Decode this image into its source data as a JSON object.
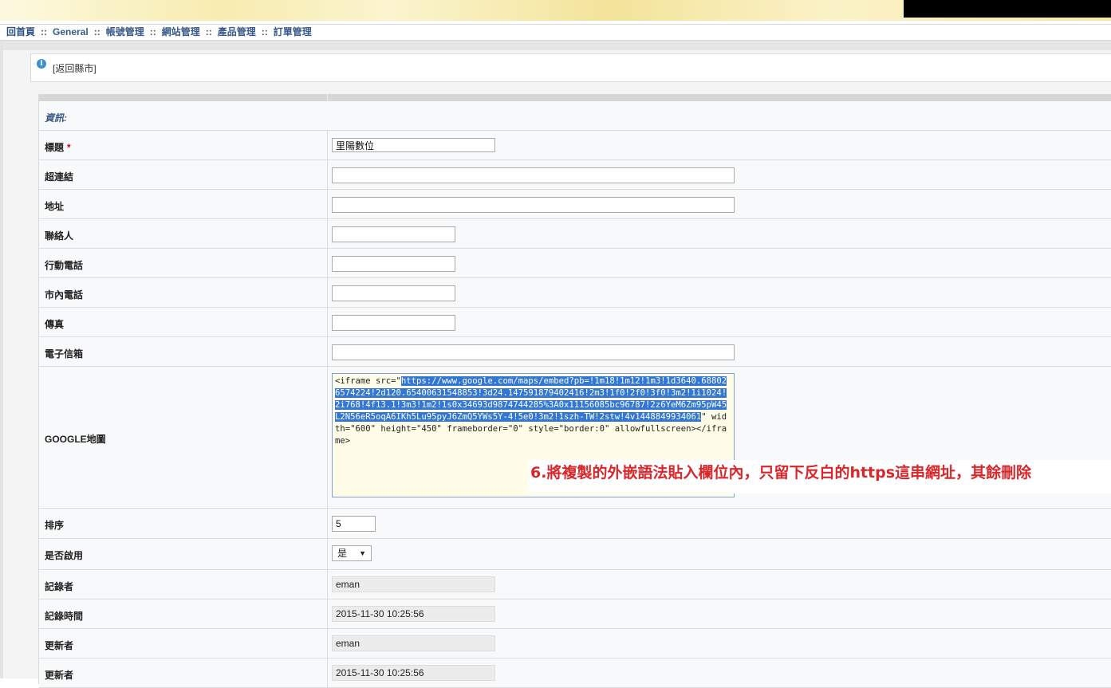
{
  "menu": {
    "items": [
      "回首頁",
      "General",
      "帳號管理",
      "網站管理",
      "產品管理",
      "訂單管理"
    ],
    "separator": "::"
  },
  "notice": {
    "back_link": "[返回縣市]"
  },
  "form": {
    "section_label": "資訊:",
    "fields": {
      "title": {
        "label": "標題",
        "required_mark": "*",
        "value": "里陽數位"
      },
      "link": {
        "label": "超連結",
        "value": ""
      },
      "address": {
        "label": "地址",
        "value": ""
      },
      "contact": {
        "label": "聯絡人",
        "value": ""
      },
      "mobile": {
        "label": "行動電話",
        "value": ""
      },
      "phone": {
        "label": "市內電話",
        "value": ""
      },
      "fax": {
        "label": "傳真",
        "value": ""
      },
      "email": {
        "label": "電子信箱",
        "value": ""
      },
      "map": {
        "label": "GOOGLE地圖",
        "code_prefix": "<iframe src=\"",
        "code_url": "https://www.google.com/maps/embed?pb=!1m18!1m12!1m3!1d3640.688026574224!2d120.65400631548853!3d24.147591879402416!2m3!1f0!2f0!3f0!3m2!1i1024!2i768!4f13.1!3m3!1m2!1s0x34693d9874744285%3A0x11156085bc96787!2z6YeM6Zm95pW45L2N56eR5oqA6IKh5Lu95pyJ6ZmQ5YWs5Y-4!5e0!3m2!1szh-TW!2stw!4v1448849934061",
        "code_suffix": "\" width=\"600\" height=\"450\" frameborder=\"0\" style=\"border:0\" allowfullscreen></iframe>"
      },
      "sort": {
        "label": "排序",
        "value": "5"
      },
      "enabled": {
        "label": "是否啟用",
        "value": "是"
      },
      "recorder": {
        "label": "記錄者",
        "value": "eman"
      },
      "record_time": {
        "label": "記錄時間",
        "value": "2015-11-30 10:25:56"
      },
      "updater": {
        "label": "更新者",
        "value": "eman"
      },
      "update_time": {
        "label": "更新者",
        "value": "2015-11-30 10:25:56"
      }
    }
  },
  "annotation": "6.將複製的外嵌語法貼入欄位內，只留下反白的https這串網址，其餘刪除",
  "colors": {
    "link": "#3a5a8a",
    "highlight": "#3277d5",
    "annotation": "#d8262a",
    "required": "#dd0000"
  }
}
